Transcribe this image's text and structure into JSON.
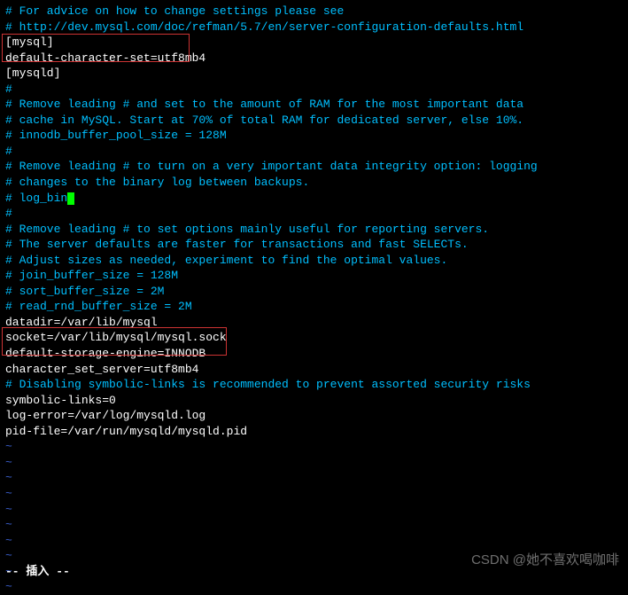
{
  "lines": [
    {
      "cls": "comment",
      "text": "# For advice on how to change settings please see"
    },
    {
      "cls": "comment",
      "text": "# http://dev.mysql.com/doc/refman/5.7/en/server-configuration-defaults.html"
    },
    {
      "cls": "white",
      "text": "[mysql]"
    },
    {
      "cls": "white",
      "text": "default-character-set=utf8mb4"
    },
    {
      "cls": "white",
      "text": ""
    },
    {
      "cls": "white",
      "text": "[mysqld]"
    },
    {
      "cls": "comment",
      "text": "#"
    },
    {
      "cls": "comment",
      "text": "# Remove leading # and set to the amount of RAM for the most important data"
    },
    {
      "cls": "comment",
      "text": "# cache in MySQL. Start at 70% of total RAM for dedicated server, else 10%."
    },
    {
      "cls": "comment",
      "text": "# innodb_buffer_pool_size = 128M"
    },
    {
      "cls": "comment",
      "text": "#"
    },
    {
      "cls": "comment",
      "text": "# Remove leading # to turn on a very important data integrity option: logging"
    },
    {
      "cls": "comment",
      "text": "# changes to the binary log between backups."
    },
    {
      "cls": "comment",
      "text": "# log_bin",
      "cursor": true
    },
    {
      "cls": "comment",
      "text": "#"
    },
    {
      "cls": "comment",
      "text": "# Remove leading # to set options mainly useful for reporting servers."
    },
    {
      "cls": "comment",
      "text": "# The server defaults are faster for transactions and fast SELECTs."
    },
    {
      "cls": "comment",
      "text": "# Adjust sizes as needed, experiment to find the optimal values."
    },
    {
      "cls": "comment",
      "text": "# join_buffer_size = 128M"
    },
    {
      "cls": "comment",
      "text": "# sort_buffer_size = 2M"
    },
    {
      "cls": "comment",
      "text": "# read_rnd_buffer_size = 2M"
    },
    {
      "cls": "white",
      "text": "datadir=/var/lib/mysql"
    },
    {
      "cls": "white",
      "text": "socket=/var/lib/mysql/mysql.sock"
    },
    {
      "cls": "white",
      "text": "default-storage-engine=INNODB"
    },
    {
      "cls": "white",
      "text": "character_set_server=utf8mb4"
    },
    {
      "cls": "comment",
      "text": "# Disabling symbolic-links is recommended to prevent assorted security risks"
    },
    {
      "cls": "white",
      "text": "symbolic-links=0"
    },
    {
      "cls": "white",
      "text": ""
    },
    {
      "cls": "white",
      "text": "log-error=/var/log/mysqld.log"
    },
    {
      "cls": "white",
      "text": "pid-file=/var/run/mysqld/mysqld.pid"
    },
    {
      "cls": "white",
      "text": ""
    },
    {
      "cls": "tilde",
      "text": "~"
    },
    {
      "cls": "tilde",
      "text": "~"
    },
    {
      "cls": "tilde",
      "text": "~"
    },
    {
      "cls": "tilde",
      "text": "~"
    },
    {
      "cls": "tilde",
      "text": "~"
    },
    {
      "cls": "tilde",
      "text": "~"
    },
    {
      "cls": "tilde",
      "text": "~"
    },
    {
      "cls": "tilde",
      "text": "~"
    },
    {
      "cls": "tilde",
      "text": "~"
    },
    {
      "cls": "tilde",
      "text": "~"
    }
  ],
  "status": "-- 插入 --",
  "watermark": "CSDN @她不喜欢喝咖啡",
  "watermark2": ""
}
